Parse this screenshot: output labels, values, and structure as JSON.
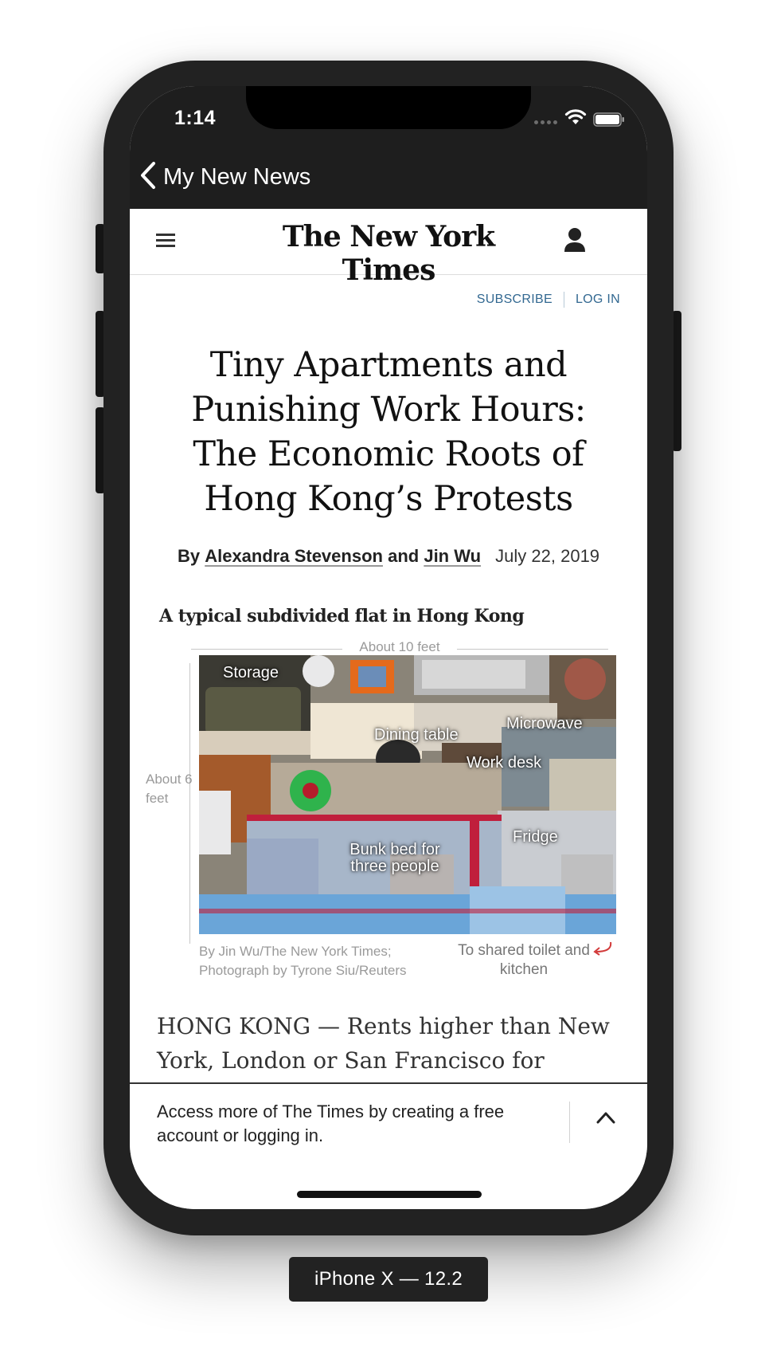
{
  "status_bar": {
    "time": "1:14"
  },
  "nav": {
    "back_label": "My New News"
  },
  "header": {
    "masthead": "The New York Times"
  },
  "account_links": {
    "subscribe": "SUBSCRIBE",
    "login": "LOG IN"
  },
  "article": {
    "headline": "Tiny Apartments and Punishing Work Hours: The Economic Roots of Hong Kong’s Protests",
    "byline_prefix": "By",
    "author_1": "Alexandra Stevenson",
    "byline_and": "and",
    "author_2": "Jin Wu",
    "date": "July 22, 2019",
    "body_start": "HONG KONG — Rents higher than New York, London or San Francisco for"
  },
  "graphic": {
    "title": "A typical subdivided flat in Hong Kong",
    "width_label": "About 10 feet",
    "height_label": "About 6 feet",
    "labels": {
      "storage": "Storage",
      "dining_table": "Dining table",
      "microwave": "Microwave",
      "work_desk": "Work desk",
      "fridge": "Fridge",
      "bunk_bed": "Bunk bed for three people"
    },
    "credit": "By Jin Wu/The New York Times; Photograph by Tyrone Siu/Reuters",
    "toilet_label": "To shared toilet and kitchen"
  },
  "sheet": {
    "message": "Access more of The Times by creating a free account or logging in."
  },
  "device": {
    "label": "iPhone X — 12.2"
  },
  "colors": {
    "link": "#326891",
    "frame": "#222222"
  }
}
